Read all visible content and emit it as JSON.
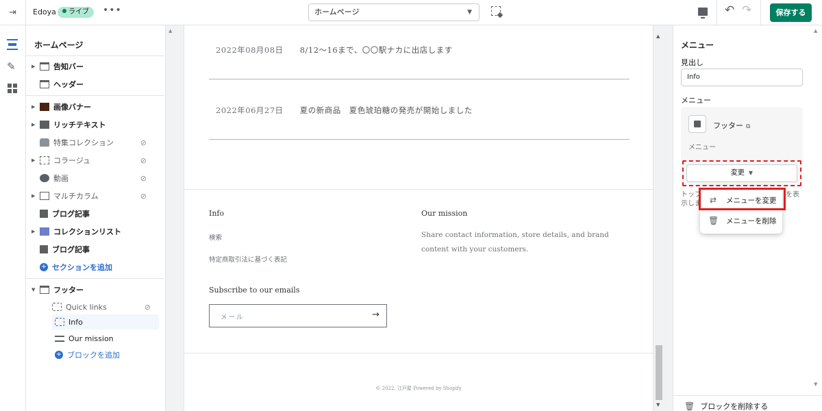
{
  "topbar": {
    "store_name": "Edoya",
    "live_badge": "ライブ",
    "more": "•••",
    "page_select": "ホームページ",
    "save_label": "保存する"
  },
  "sidebar": {
    "title": "ホームページ",
    "items": [
      {
        "label": "告知バー"
      },
      {
        "label": "ヘッダー"
      },
      {
        "label": "画像バナー"
      },
      {
        "label": "リッチテキスト"
      },
      {
        "label": "特集コレクション"
      },
      {
        "label": "コラージュ"
      },
      {
        "label": "動画"
      },
      {
        "label": "マルチカラム"
      },
      {
        "label": "ブログ記事"
      },
      {
        "label": "コレクションリスト"
      },
      {
        "label": "ブログ記事"
      },
      {
        "label": "セクションを追加"
      }
    ],
    "footer": {
      "label": "フッター",
      "blocks": [
        {
          "label": "Quick links"
        },
        {
          "label": "Info"
        },
        {
          "label": "Our mission"
        },
        {
          "label": "ブロックを追加"
        }
      ]
    }
  },
  "preview": {
    "news": [
      {
        "date": "2022年08月08日",
        "title": "8/12～16まで、〇〇駅ナカに出店します"
      },
      {
        "date": "2022年06月27日",
        "title": "夏の新商品　夏色琥珀糖の発売が開始しました"
      }
    ],
    "footer": {
      "info_heading": "Info",
      "info_links": [
        "検索",
        "特定商取引法に基づく表記"
      ],
      "mission_heading": "Our mission",
      "mission_text": "Share contact information, store details, and brand content with your customers.",
      "subscribe_heading": "Subscribe to our emails",
      "email_placeholder": "メール",
      "arrow": "→",
      "copyright": "© 2022, 江戸屋 Powered by Shopify"
    }
  },
  "panel": {
    "title": "メニュー",
    "heading_label": "見出し",
    "heading_value": "Info",
    "menu_label": "メニュー",
    "menu_name": "フッター",
    "menu_sub": "メニュー",
    "change_button": "変更",
    "help_left": "トッフ\n示しま",
    "help_right": "を表",
    "popover": {
      "change_menu": "メニューを変更",
      "delete_menu": "メニューを削除"
    },
    "delete_block": "ブロックを削除する"
  },
  "colors": {
    "save_green": "#008060",
    "link_blue": "#2c6ecb",
    "highlight_red": "#e01e1e",
    "live_badge": "#aee9d1"
  }
}
